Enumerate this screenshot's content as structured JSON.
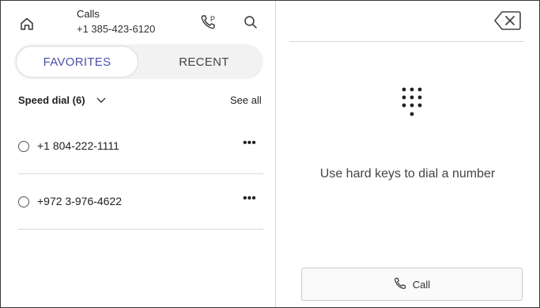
{
  "header": {
    "title": "Calls",
    "number": "+1 385-423-6120",
    "icons": [
      "home-icon",
      "voicemail-call-icon",
      "search-icon"
    ]
  },
  "tabs": [
    {
      "label": "FAVORITES",
      "selected": true
    },
    {
      "label": "RECENT",
      "selected": false
    }
  ],
  "speed_dial": {
    "label": "Speed dial (6)",
    "see_all": "See all",
    "items": [
      {
        "number": "+1 804-222-1111",
        "more": "•••"
      },
      {
        "number": "+972 3-976-4622",
        "more": "•••"
      }
    ]
  },
  "dialer": {
    "hint": "Use hard keys to dial a number",
    "call_label": "Call",
    "icons": [
      "backspace-icon",
      "keypad-icon",
      "phone-icon"
    ]
  },
  "colors": {
    "accent": "#4a4fa8",
    "border": "#d6d6d6"
  }
}
